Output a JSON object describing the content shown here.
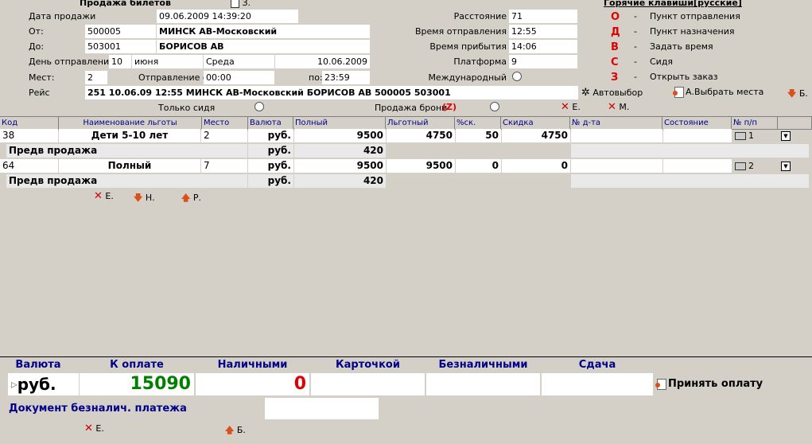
{
  "header": {
    "title": "Продажа билетов",
    "save_hotkey": "З.",
    "hotkeys_title": "Горячие клавиши[русские]"
  },
  "form": {
    "sale_date_label": "Дата продажи",
    "sale_date": "09.06.2009 14:39:20",
    "from_label": "От:",
    "from_code": "500005",
    "from_name": "МИНСК АВ-Московский",
    "to_label": "До:",
    "to_code": "503001",
    "to_name": "БОРИСОВ АВ",
    "dep_day_label": "День отправления",
    "dep_day": "10",
    "dep_month": "июня",
    "dep_weekday": "Среда",
    "dep_date": "10.06.2009",
    "seats_label": "Мест:",
    "seats": "2",
    "dep_from_label": "Отправление с:",
    "dep_from": "00:00",
    "dep_to_label": "по:",
    "dep_to": "23:59",
    "route_label": "Рейс",
    "route": "251 10.06.09 12:55 МИНСК АВ-Московский БОРИСОВ АВ 500005 503001",
    "distance_label": "Расстояние",
    "distance": "71",
    "dep_time_label": "Время отправления",
    "dep_time": "12:55",
    "arr_time_label": "Время прибытия",
    "arr_time": "14:06",
    "platform_label": "Платформа",
    "platform": "9",
    "intl_label": "Международный",
    "autoselect_label": "Автовыбор",
    "choose_seats_label": "А.Выбрать места",
    "b_label": "Б.",
    "seated_only_label": "Только сидя",
    "booking_sale_label": "Продажа брони",
    "booking_sale_hotkey": "(Z)",
    "e_label": "Е.",
    "m_label": "М."
  },
  "hotkeys": [
    {
      "key": "О",
      "dash": "-",
      "desc": "Пункт отправления"
    },
    {
      "key": "Д",
      "dash": "-",
      "desc": "Пункт назначения"
    },
    {
      "key": "В",
      "dash": "-",
      "desc": "Задать время"
    },
    {
      "key": "С",
      "dash": "-",
      "desc": "Сидя"
    },
    {
      "key": "З",
      "dash": "-",
      "desc": "Открыть заказ"
    }
  ],
  "grid": {
    "columns": [
      "Код",
      "Наименование льготы",
      "Место",
      "Валюта",
      "Полный",
      "Льготный",
      "%ск.",
      "Скидка",
      "№ д-та",
      "Состояние",
      "№ п/п"
    ],
    "rows": [
      {
        "code": "38",
        "name": "Дети 5-10 лет",
        "seat": "2",
        "currency": "руб.",
        "full": "9500",
        "benefit": "4750",
        "pct": "50",
        "discount": "4750",
        "num": "1",
        "sub_label": "Предв продажа",
        "sub_currency": "руб.",
        "sub_amount": "420"
      },
      {
        "code": "64",
        "name": "Полный",
        "seat": "7",
        "currency": "руб.",
        "full": "9500",
        "benefit": "9500",
        "pct": "0",
        "discount": "0",
        "num": "2",
        "sub_label": "Предв продажа",
        "sub_currency": "руб.",
        "sub_amount": "420"
      }
    ],
    "actions": {
      "e": "Е.",
      "n": "Н.",
      "r": "Р."
    }
  },
  "payment": {
    "headers": [
      "Валюта",
      "К оплате",
      "Наличными",
      "Карточкой",
      "Безналичными",
      "Сдача"
    ],
    "currency": "руб.",
    "to_pay": "15090",
    "cash": "0",
    "accept_label": "Принять оплату",
    "doc_label": "Документ безналич. платежа",
    "e_label": "Е.",
    "b_label": "Б."
  },
  "colors": {
    "hotkey": "#e00000",
    "to_pay": "#008000",
    "cash": "#e00000",
    "header_blue": "#00008b"
  }
}
